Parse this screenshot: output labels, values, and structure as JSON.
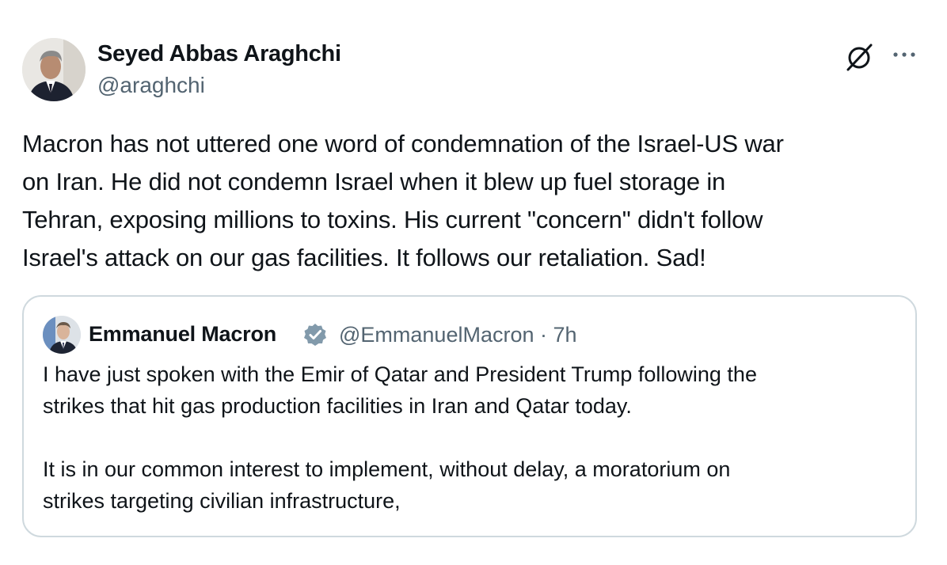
{
  "author": {
    "name": "Seyed Abbas Araghchi",
    "handle": "@araghchi",
    "avatar_icon": "profile-photo-man-in-suit"
  },
  "actions": {
    "grok_icon": "grok-icon",
    "more_label": "···"
  },
  "tweet_lines": [
    "Macron has not uttered one word of condemnation of the Israel-US war",
    "on Iran. He did not condemn Israel when it blew up fuel storage in",
    "Tehran, exposing millions to toxins. His current \"concern\" didn't follow",
    "Israel's attack on our gas facilities. It follows our retaliation. Sad!"
  ],
  "quote": {
    "name": "Emmanuel Macron",
    "verified_icon": "verified-badge-icon",
    "handle_time": "@EmmanuelMacron · 7h",
    "lines": [
      "I have just spoken with the Emir of Qatar and President Trump following the",
      "strikes that hit gas production facilities in Iran and Qatar today.",
      "",
      "It is in our common interest to implement, without delay, a moratorium on",
      "strikes targeting civilian infrastructure,"
    ]
  },
  "colors": {
    "text": "#0f1419",
    "secondary": "#536471",
    "border": "#cfd9de",
    "verified_badge": "#829aab"
  }
}
